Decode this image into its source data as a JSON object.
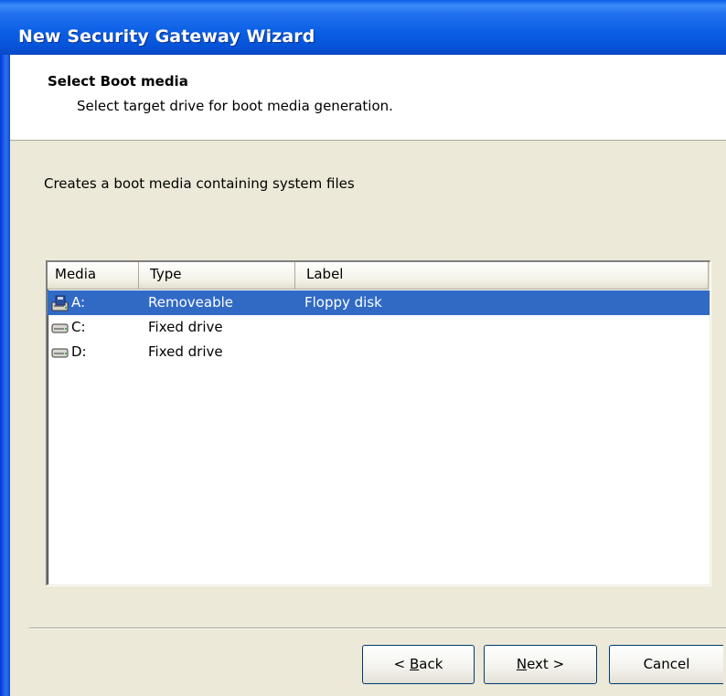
{
  "window": {
    "title": "New Security Gateway Wizard"
  },
  "header": {
    "title": "Select Boot media",
    "subtitle": "Select target drive for boot media generation."
  },
  "description": "Creates a boot media containing system files",
  "listview": {
    "columns": [
      "Media",
      "Type",
      "Label"
    ],
    "rows": [
      {
        "media": "A:",
        "type": "Removeable",
        "label": "Floppy disk",
        "icon": "floppy-drive-icon",
        "selected": true
      },
      {
        "media": "C:",
        "type": "Fixed drive",
        "label": "",
        "icon": "hard-drive-icon",
        "selected": false
      },
      {
        "media": "D:",
        "type": "Fixed drive",
        "label": "",
        "icon": "hard-drive-icon",
        "selected": false
      }
    ]
  },
  "buttons": {
    "back": {
      "prefix": "< ",
      "mnemonic": "B",
      "rest": "ack"
    },
    "next": {
      "mnemonic": "N",
      "rest": "ext >"
    },
    "cancel": "Cancel"
  },
  "colors": {
    "titlebar": "#0A5EE4",
    "selection": "#316AC5",
    "dialog_background": "#ECE9D8"
  }
}
